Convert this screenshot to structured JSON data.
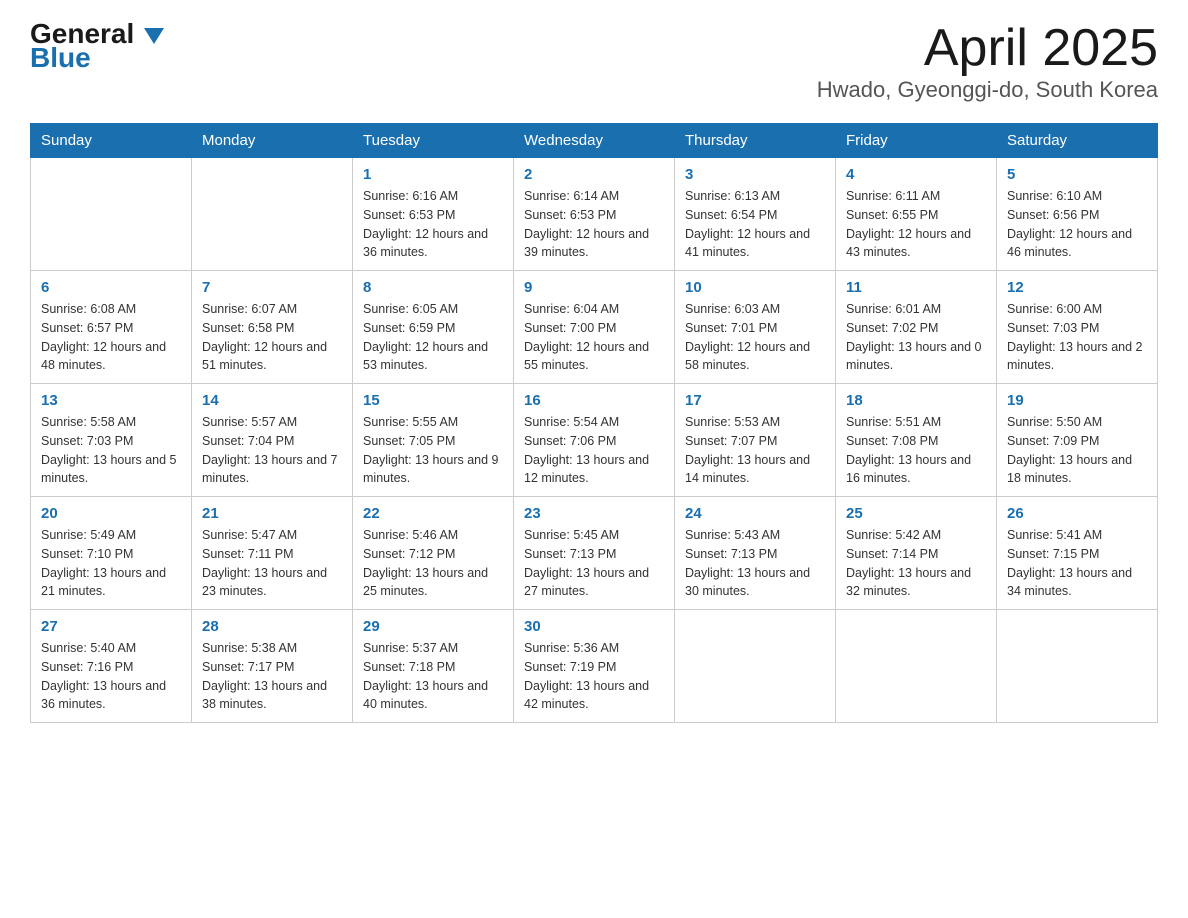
{
  "logo": {
    "line1": "General",
    "line2": "Blue"
  },
  "title": "April 2025",
  "subtitle": "Hwado, Gyeonggi-do, South Korea",
  "days_of_week": [
    "Sunday",
    "Monday",
    "Tuesday",
    "Wednesday",
    "Thursday",
    "Friday",
    "Saturday"
  ],
  "weeks": [
    [
      {
        "day": "",
        "sunrise": "",
        "sunset": "",
        "daylight": ""
      },
      {
        "day": "",
        "sunrise": "",
        "sunset": "",
        "daylight": ""
      },
      {
        "day": "1",
        "sunrise": "Sunrise: 6:16 AM",
        "sunset": "Sunset: 6:53 PM",
        "daylight": "Daylight: 12 hours and 36 minutes."
      },
      {
        "day": "2",
        "sunrise": "Sunrise: 6:14 AM",
        "sunset": "Sunset: 6:53 PM",
        "daylight": "Daylight: 12 hours and 39 minutes."
      },
      {
        "day": "3",
        "sunrise": "Sunrise: 6:13 AM",
        "sunset": "Sunset: 6:54 PM",
        "daylight": "Daylight: 12 hours and 41 minutes."
      },
      {
        "day": "4",
        "sunrise": "Sunrise: 6:11 AM",
        "sunset": "Sunset: 6:55 PM",
        "daylight": "Daylight: 12 hours and 43 minutes."
      },
      {
        "day": "5",
        "sunrise": "Sunrise: 6:10 AM",
        "sunset": "Sunset: 6:56 PM",
        "daylight": "Daylight: 12 hours and 46 minutes."
      }
    ],
    [
      {
        "day": "6",
        "sunrise": "Sunrise: 6:08 AM",
        "sunset": "Sunset: 6:57 PM",
        "daylight": "Daylight: 12 hours and 48 minutes."
      },
      {
        "day": "7",
        "sunrise": "Sunrise: 6:07 AM",
        "sunset": "Sunset: 6:58 PM",
        "daylight": "Daylight: 12 hours and 51 minutes."
      },
      {
        "day": "8",
        "sunrise": "Sunrise: 6:05 AM",
        "sunset": "Sunset: 6:59 PM",
        "daylight": "Daylight: 12 hours and 53 minutes."
      },
      {
        "day": "9",
        "sunrise": "Sunrise: 6:04 AM",
        "sunset": "Sunset: 7:00 PM",
        "daylight": "Daylight: 12 hours and 55 minutes."
      },
      {
        "day": "10",
        "sunrise": "Sunrise: 6:03 AM",
        "sunset": "Sunset: 7:01 PM",
        "daylight": "Daylight: 12 hours and 58 minutes."
      },
      {
        "day": "11",
        "sunrise": "Sunrise: 6:01 AM",
        "sunset": "Sunset: 7:02 PM",
        "daylight": "Daylight: 13 hours and 0 minutes."
      },
      {
        "day": "12",
        "sunrise": "Sunrise: 6:00 AM",
        "sunset": "Sunset: 7:03 PM",
        "daylight": "Daylight: 13 hours and 2 minutes."
      }
    ],
    [
      {
        "day": "13",
        "sunrise": "Sunrise: 5:58 AM",
        "sunset": "Sunset: 7:03 PM",
        "daylight": "Daylight: 13 hours and 5 minutes."
      },
      {
        "day": "14",
        "sunrise": "Sunrise: 5:57 AM",
        "sunset": "Sunset: 7:04 PM",
        "daylight": "Daylight: 13 hours and 7 minutes."
      },
      {
        "day": "15",
        "sunrise": "Sunrise: 5:55 AM",
        "sunset": "Sunset: 7:05 PM",
        "daylight": "Daylight: 13 hours and 9 minutes."
      },
      {
        "day": "16",
        "sunrise": "Sunrise: 5:54 AM",
        "sunset": "Sunset: 7:06 PM",
        "daylight": "Daylight: 13 hours and 12 minutes."
      },
      {
        "day": "17",
        "sunrise": "Sunrise: 5:53 AM",
        "sunset": "Sunset: 7:07 PM",
        "daylight": "Daylight: 13 hours and 14 minutes."
      },
      {
        "day": "18",
        "sunrise": "Sunrise: 5:51 AM",
        "sunset": "Sunset: 7:08 PM",
        "daylight": "Daylight: 13 hours and 16 minutes."
      },
      {
        "day": "19",
        "sunrise": "Sunrise: 5:50 AM",
        "sunset": "Sunset: 7:09 PM",
        "daylight": "Daylight: 13 hours and 18 minutes."
      }
    ],
    [
      {
        "day": "20",
        "sunrise": "Sunrise: 5:49 AM",
        "sunset": "Sunset: 7:10 PM",
        "daylight": "Daylight: 13 hours and 21 minutes."
      },
      {
        "day": "21",
        "sunrise": "Sunrise: 5:47 AM",
        "sunset": "Sunset: 7:11 PM",
        "daylight": "Daylight: 13 hours and 23 minutes."
      },
      {
        "day": "22",
        "sunrise": "Sunrise: 5:46 AM",
        "sunset": "Sunset: 7:12 PM",
        "daylight": "Daylight: 13 hours and 25 minutes."
      },
      {
        "day": "23",
        "sunrise": "Sunrise: 5:45 AM",
        "sunset": "Sunset: 7:13 PM",
        "daylight": "Daylight: 13 hours and 27 minutes."
      },
      {
        "day": "24",
        "sunrise": "Sunrise: 5:43 AM",
        "sunset": "Sunset: 7:13 PM",
        "daylight": "Daylight: 13 hours and 30 minutes."
      },
      {
        "day": "25",
        "sunrise": "Sunrise: 5:42 AM",
        "sunset": "Sunset: 7:14 PM",
        "daylight": "Daylight: 13 hours and 32 minutes."
      },
      {
        "day": "26",
        "sunrise": "Sunrise: 5:41 AM",
        "sunset": "Sunset: 7:15 PM",
        "daylight": "Daylight: 13 hours and 34 minutes."
      }
    ],
    [
      {
        "day": "27",
        "sunrise": "Sunrise: 5:40 AM",
        "sunset": "Sunset: 7:16 PM",
        "daylight": "Daylight: 13 hours and 36 minutes."
      },
      {
        "day": "28",
        "sunrise": "Sunrise: 5:38 AM",
        "sunset": "Sunset: 7:17 PM",
        "daylight": "Daylight: 13 hours and 38 minutes."
      },
      {
        "day": "29",
        "sunrise": "Sunrise: 5:37 AM",
        "sunset": "Sunset: 7:18 PM",
        "daylight": "Daylight: 13 hours and 40 minutes."
      },
      {
        "day": "30",
        "sunrise": "Sunrise: 5:36 AM",
        "sunset": "Sunset: 7:19 PM",
        "daylight": "Daylight: 13 hours and 42 minutes."
      },
      {
        "day": "",
        "sunrise": "",
        "sunset": "",
        "daylight": ""
      },
      {
        "day": "",
        "sunrise": "",
        "sunset": "",
        "daylight": ""
      },
      {
        "day": "",
        "sunrise": "",
        "sunset": "",
        "daylight": ""
      }
    ]
  ]
}
